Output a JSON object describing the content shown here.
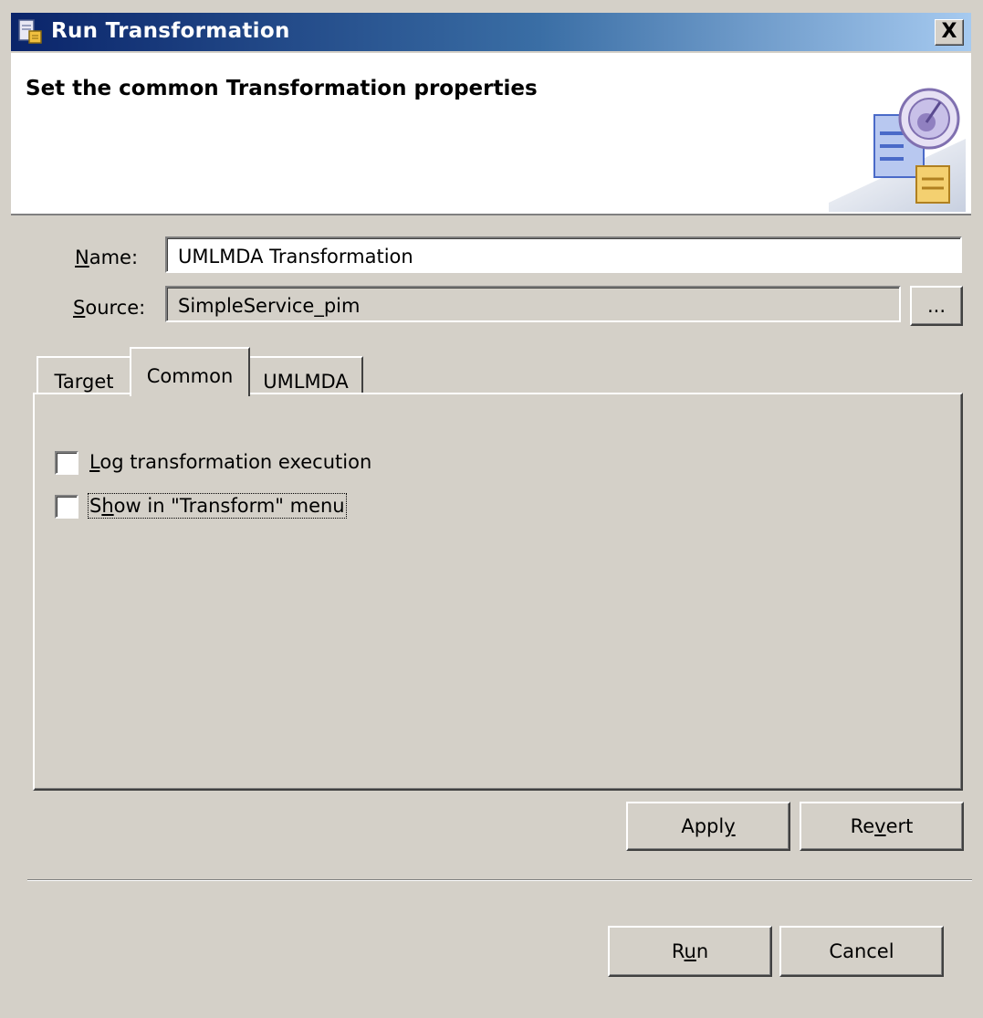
{
  "window": {
    "title": "Run Transformation",
    "close_label": "X",
    "accent_color": "#0a246a"
  },
  "header": {
    "title": "Set the common Transformation properties",
    "art_icon": "transformation-wizard-icon"
  },
  "form": {
    "name_label_accel": "N",
    "name_label_rest": "ame:",
    "name_value": "UMLMDA Transformation",
    "source_label_accel": "S",
    "source_label_rest": "ource:",
    "source_value": "SimpleService_pim",
    "browse_label": "..."
  },
  "tabs": [
    {
      "label": "Target",
      "selected": false
    },
    {
      "label": "Common",
      "selected": true
    },
    {
      "label": "UMLMDA",
      "selected": false
    }
  ],
  "common_tab": {
    "log_accel": "L",
    "log_rest": "og transformation execution",
    "log_checked": false,
    "show_accel_pre": "S",
    "show_accel": "h",
    "show_rest": "ow in \"Transform\" menu",
    "show_checked": false
  },
  "panel_buttons": {
    "apply_pre": "Appl",
    "apply_accel": "y",
    "apply_post": "",
    "revert_pre": "Re",
    "revert_accel": "v",
    "revert_post": "ert"
  },
  "dialog_buttons": {
    "run_pre": "R",
    "run_accel": "u",
    "run_post": "n",
    "cancel_label": "Cancel"
  }
}
